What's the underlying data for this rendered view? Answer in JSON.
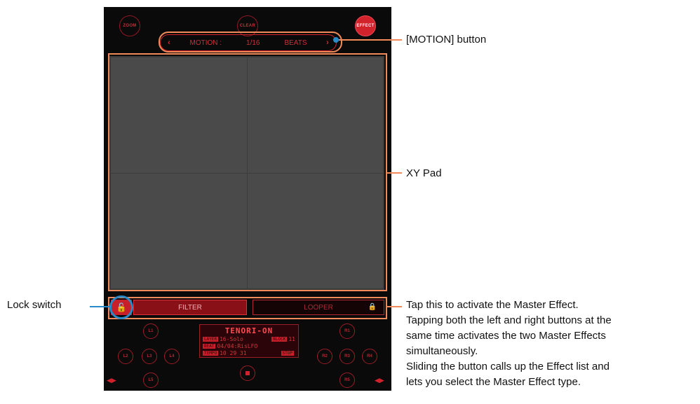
{
  "top": {
    "zoom": "ZOOM",
    "clear": "CLEAR",
    "effect": "EFFECT"
  },
  "motion": {
    "prev": "‹",
    "label": "MOTION :",
    "value": "1/16",
    "unit": "BEATS",
    "next": "›"
  },
  "effects": {
    "lock": "🔓",
    "filter": "FILTER",
    "looper": "LOOPER",
    "looper_lock": "🔒"
  },
  "left_buttons": [
    "L1",
    "L2",
    "L3",
    "L4",
    "L5"
  ],
  "right_buttons": [
    "R1",
    "R2",
    "R3",
    "R4",
    "R5"
  ],
  "display": {
    "title": "TENORI-ON",
    "rows": [
      {
        "tag": "LAYER",
        "value": "16-Solo",
        "tag2": "BLOCK",
        "value2": "11"
      },
      {
        "tag": "BEAT",
        "value": "04/04:RisLFO",
        "tag2": "",
        "value2": ""
      },
      {
        "tag": "TEMPO",
        "value": "10 29 31",
        "tag2": "STOP",
        "value2": ""
      }
    ]
  },
  "annotations": {
    "motion": "[MOTION] button",
    "xy": "XY Pad",
    "lock": "Lock switch",
    "master_lines": [
      "Tap this to activate the Master Effect.",
      "Tapping both the left and right buttons at the",
      "same time activates the two Master Effects",
      "simultaneously.",
      "Sliding the button calls up the Effect list and",
      "lets you select the Master Effect type."
    ]
  },
  "colors": {
    "accent": "#d2222c",
    "callout_line": "#2a8ac8",
    "highlight_box": "#f08a5a",
    "pad": "#4a4a4a"
  }
}
